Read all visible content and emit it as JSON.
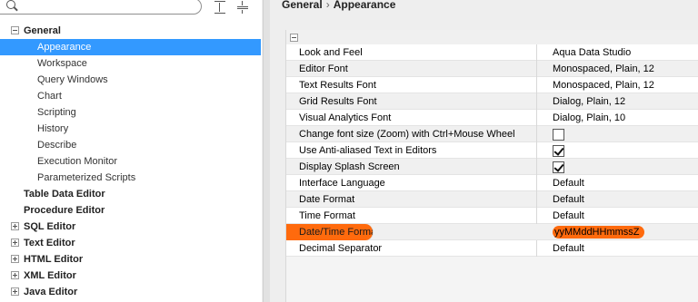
{
  "breadcrumb": {
    "parent": "General",
    "current": "Appearance"
  },
  "search": {
    "placeholder": "",
    "value": ""
  },
  "tree": [
    {
      "label": "General",
      "bold": true,
      "toggle": "minus",
      "indent": 0,
      "selected": false
    },
    {
      "label": "Appearance",
      "bold": false,
      "toggle": "",
      "indent": 1,
      "selected": true
    },
    {
      "label": "Workspace",
      "bold": false,
      "toggle": "",
      "indent": 1,
      "selected": false
    },
    {
      "label": "Query Windows",
      "bold": false,
      "toggle": "",
      "indent": 1,
      "selected": false
    },
    {
      "label": "Chart",
      "bold": false,
      "toggle": "",
      "indent": 1,
      "selected": false
    },
    {
      "label": "Scripting",
      "bold": false,
      "toggle": "",
      "indent": 1,
      "selected": false
    },
    {
      "label": "History",
      "bold": false,
      "toggle": "",
      "indent": 1,
      "selected": false
    },
    {
      "label": "Describe",
      "bold": false,
      "toggle": "",
      "indent": 1,
      "selected": false
    },
    {
      "label": "Execution Monitor",
      "bold": false,
      "toggle": "",
      "indent": 1,
      "selected": false
    },
    {
      "label": "Parameterized Scripts",
      "bold": false,
      "toggle": "",
      "indent": 1,
      "selected": false
    },
    {
      "label": "Table Data Editor",
      "bold": true,
      "toggle": "",
      "indent": 0,
      "selected": false
    },
    {
      "label": "Procedure Editor",
      "bold": true,
      "toggle": "",
      "indent": 0,
      "selected": false
    },
    {
      "label": "SQL Editor",
      "bold": true,
      "toggle": "plus",
      "indent": 0,
      "selected": false
    },
    {
      "label": "Text Editor",
      "bold": true,
      "toggle": "plus",
      "indent": 0,
      "selected": false
    },
    {
      "label": "HTML Editor",
      "bold": true,
      "toggle": "plus",
      "indent": 0,
      "selected": false
    },
    {
      "label": "XML Editor",
      "bold": true,
      "toggle": "plus",
      "indent": 0,
      "selected": false
    },
    {
      "label": "Java Editor",
      "bold": true,
      "toggle": "plus",
      "indent": 0,
      "selected": false
    }
  ],
  "properties": [
    {
      "name": "Look and Feel",
      "value": "Aqua Data Studio",
      "type": "text"
    },
    {
      "name": "Editor Font",
      "value": "Monospaced, Plain, 12",
      "type": "text"
    },
    {
      "name": "Text Results Font",
      "value": "Monospaced, Plain, 12",
      "type": "text"
    },
    {
      "name": "Grid Results Font",
      "value": "Dialog, Plain, 12",
      "type": "text"
    },
    {
      "name": "Visual Analytics Font",
      "value": "Dialog, Plain, 10",
      "type": "text"
    },
    {
      "name": "Change font size (Zoom) with Ctrl+Mouse Wheel",
      "checked": false,
      "type": "checkbox"
    },
    {
      "name": "Use Anti-aliased Text in Editors",
      "checked": true,
      "type": "checkbox"
    },
    {
      "name": "Display Splash Screen",
      "checked": true,
      "type": "checkbox"
    },
    {
      "name": "Interface Language",
      "value": "Default",
      "type": "text"
    },
    {
      "name": "Date Format",
      "value": "Default",
      "type": "text"
    },
    {
      "name": "Time Format",
      "value": "Default",
      "type": "text"
    },
    {
      "name": "Date/Time Format",
      "value": "yyMMddHHmmssZ",
      "type": "text",
      "highlight": true
    },
    {
      "name": "Decimal Separator",
      "value": "Default",
      "type": "text"
    }
  ],
  "colors": {
    "selection": "#3399ff",
    "highlight": "#ff6a0d"
  },
  "icons": {
    "search": "search-icon",
    "expand_all": "expand-all-icon",
    "collapse_all": "collapse-all-icon"
  }
}
